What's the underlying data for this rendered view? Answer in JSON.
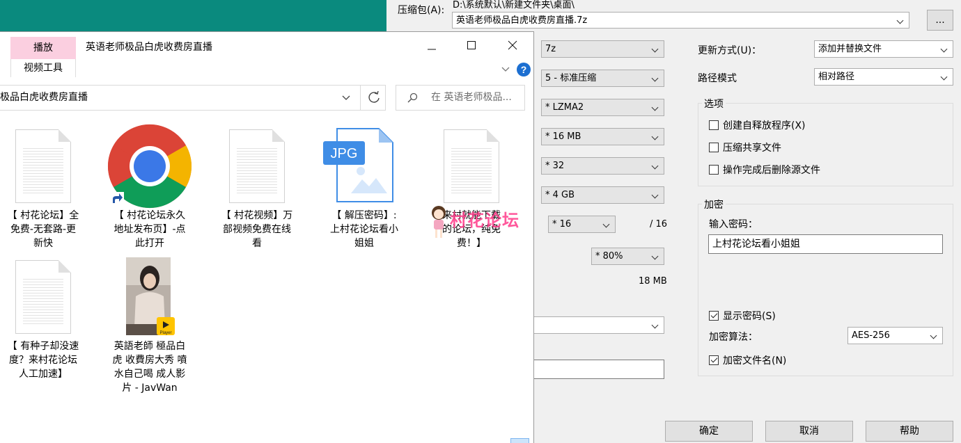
{
  "zip": {
    "archive_label": "压缩包(A):",
    "archive_path": "D:\\系统默认\\新建文件夹\\桌面\\",
    "archive_name": "英语老师极品白虎收费房直播.7z",
    "browse_label": "...",
    "format_value": "7z",
    "level_value": "5 - 标准压缩",
    "method_value": "* LZMA2",
    "dict_value": "* 16 MB",
    "word_value": "* 32",
    "solid_value": "* 4 GB",
    "threads_value": "* 16",
    "threads_total": "/ 16",
    "memory_value": "* 80%",
    "memory_size": "18 MB",
    "update_label": "更新方式(U)：",
    "update_value": "添加并替换文件",
    "path_label": "路径模式",
    "path_value": "相对路径",
    "options": {
      "title": "选项",
      "sfx": "创建自释放程序(X)",
      "shared": "压缩共享文件",
      "delete": "操作完成后删除源文件"
    },
    "encryption": {
      "title": "加密",
      "enter_label": "输入密码：",
      "password": "上村花论坛看小姐姐",
      "show_password": "显示密码(S)",
      "method_label": "加密算法：",
      "method_value": "AES-256",
      "encrypt_names": "加密文件名(N)"
    },
    "buttons": {
      "ok": "确定",
      "cancel": "取消",
      "help": "帮助"
    }
  },
  "explorer": {
    "tab_play": "播放",
    "tab_video_tools": "视频工具",
    "title": "英语老师极品白虎收费房直播",
    "address": "极品白虎收费房直播",
    "search_placeholder": "在 英语老师极品...",
    "files": [
      {
        "name_lines": [
          "【 村花论坛】全",
          "免费-无套路-更",
          "新快"
        ],
        "icon": "text-document-icon"
      },
      {
        "name_lines": [
          "【 村花论坛永久",
          "地址发布页】-点",
          "此打开"
        ],
        "icon": "chrome-shortcut-icon"
      },
      {
        "name_lines": [
          "【 村花视频】万",
          "部视频免费在线",
          "看"
        ],
        "icon": "text-document-icon"
      },
      {
        "name_lines": [
          "【 解压密码】:",
          "上村花论坛看小",
          "姐姐"
        ],
        "icon": "jpg-file-icon"
      },
      {
        "name_lines": [
          "来村就能下载",
          "的论坛，纯免",
          "费！】"
        ],
        "icon": "text-document-icon"
      },
      {
        "name_lines": [
          "【 有种子却没速",
          "度？来村花论坛",
          "人工加速】"
        ],
        "icon": "text-document-icon"
      },
      {
        "name_lines": [
          "英語老師 極品白",
          "虎 收費房大秀 噴",
          "水自己喝 成人影",
          "片 - JavWan"
        ],
        "icon": "video-thumbnail"
      }
    ],
    "watermark": "村花论坛",
    "player_badge": "Player"
  },
  "colors": {
    "desktop_teal": "#0a8a7e",
    "play_tab_pink": "#fbcfe0",
    "watermark_pink": "#ff3c8a",
    "help_blue": "#1c6fd1"
  }
}
